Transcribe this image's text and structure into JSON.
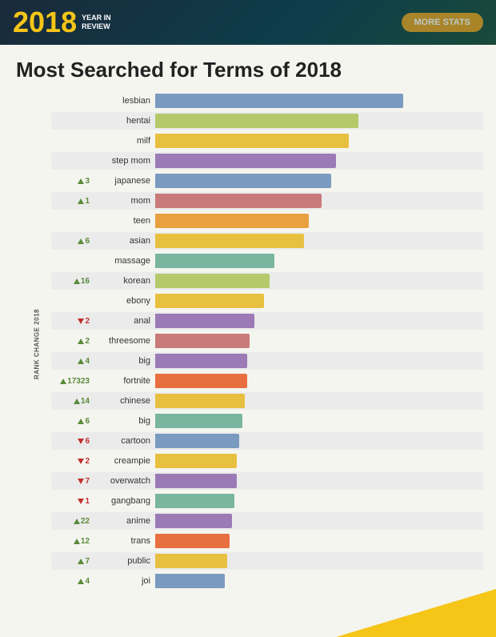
{
  "header": {
    "year": "2018",
    "tagline_line1": "YEAR IN",
    "tagline_line2": "REVIEW",
    "button_label": "MORE STATS"
  },
  "page_title": "Most Searched for Terms of 2018",
  "y_axis_label": "RANK CHANGE 2018",
  "bars": [
    {
      "term": "lesbian",
      "rank_dir": "",
      "rank_num": "",
      "pct": 100,
      "color": 0,
      "stripe": false
    },
    {
      "term": "hentai",
      "rank_dir": "",
      "rank_num": "",
      "pct": 82,
      "color": 1,
      "stripe": true
    },
    {
      "term": "milf",
      "rank_dir": "",
      "rank_num": "",
      "pct": 78,
      "color": 2,
      "stripe": false
    },
    {
      "term": "step mom",
      "rank_dir": "",
      "rank_num": "",
      "pct": 73,
      "color": 3,
      "stripe": true
    },
    {
      "term": "japanese",
      "rank_dir": "up",
      "rank_num": "3",
      "pct": 71,
      "color": 4,
      "stripe": false
    },
    {
      "term": "mom",
      "rank_dir": "up",
      "rank_num": "1",
      "pct": 67,
      "color": 5,
      "stripe": true
    },
    {
      "term": "teen",
      "rank_dir": "",
      "rank_num": "",
      "pct": 62,
      "color": 6,
      "stripe": false
    },
    {
      "term": "asian",
      "rank_dir": "up",
      "rank_num": "6",
      "pct": 60,
      "color": 7,
      "stripe": true
    },
    {
      "term": "massage",
      "rank_dir": "",
      "rank_num": "",
      "pct": 48,
      "color": 8,
      "stripe": false
    },
    {
      "term": "korean",
      "rank_dir": "up",
      "rank_num": "16",
      "pct": 46,
      "color": 9,
      "stripe": true
    },
    {
      "term": "ebony",
      "rank_dir": "",
      "rank_num": "",
      "pct": 44,
      "color": 10,
      "stripe": false
    },
    {
      "term": "anal",
      "rank_dir": "dn",
      "rank_num": "2",
      "pct": 40,
      "color": 11,
      "stripe": true
    },
    {
      "term": "threesome",
      "rank_dir": "up",
      "rank_num": "2",
      "pct": 38,
      "color": 12,
      "stripe": false
    },
    {
      "term": "big",
      "rank_dir": "up",
      "rank_num": "4",
      "pct": 37,
      "color": 13,
      "stripe": true
    },
    {
      "term": "fortnite",
      "rank_dir": "up",
      "rank_num": "17323",
      "pct": 37,
      "color": 14,
      "stripe": false
    },
    {
      "term": "chinese",
      "rank_dir": "up",
      "rank_num": "14",
      "pct": 36,
      "color": 15,
      "stripe": true
    },
    {
      "term": "big",
      "rank_dir": "up",
      "rank_num": "6",
      "pct": 35,
      "color": 16,
      "stripe": false
    },
    {
      "term": "cartoon",
      "rank_dir": "dn",
      "rank_num": "6",
      "pct": 34,
      "color": 17,
      "stripe": true
    },
    {
      "term": "creampie",
      "rank_dir": "dn",
      "rank_num": "2",
      "pct": 33,
      "color": 18,
      "stripe": false
    },
    {
      "term": "overwatch",
      "rank_dir": "dn",
      "rank_num": "7",
      "pct": 33,
      "color": 19,
      "stripe": true
    },
    {
      "term": "gangbang",
      "rank_dir": "dn",
      "rank_num": "1",
      "pct": 32,
      "color": 20,
      "stripe": false
    },
    {
      "term": "anime",
      "rank_dir": "up",
      "rank_num": "22",
      "pct": 31,
      "color": 21,
      "stripe": true
    },
    {
      "term": "trans",
      "rank_dir": "up",
      "rank_num": "12",
      "pct": 30,
      "color": 22,
      "stripe": false
    },
    {
      "term": "public",
      "rank_dir": "up",
      "rank_num": "7",
      "pct": 29,
      "color": 23,
      "stripe": true
    },
    {
      "term": "joi",
      "rank_dir": "up",
      "rank_num": "4",
      "pct": 28,
      "color": 24,
      "stripe": false
    }
  ]
}
